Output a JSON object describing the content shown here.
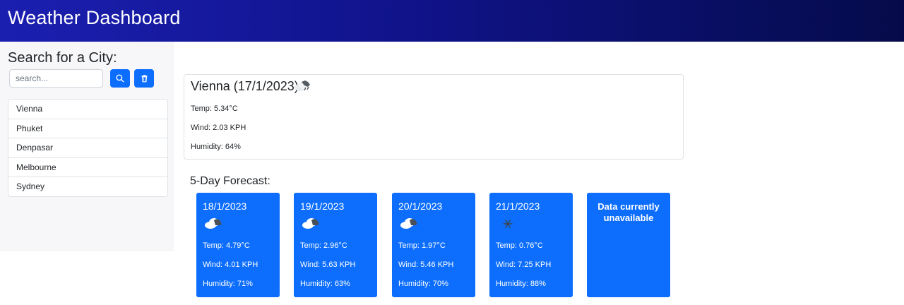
{
  "header": {
    "title": "Weather Dashboard",
    "gradient": [
      "#1b1fb0",
      "#10138a",
      "#050b4a"
    ]
  },
  "sidebar": {
    "heading": "Search for a City:",
    "search": {
      "placeholder": "search...",
      "value": ""
    },
    "search_button_icon": "search-icon",
    "clear_button_icon": "trash-icon",
    "history": [
      "Vienna",
      "Phuket",
      "Denpasar",
      "Melbourne",
      "Sydney"
    ]
  },
  "current": {
    "title": "Vienna (17/1/2023)",
    "icon": "cloud-rain-icon",
    "temp": "Temp: 5.34°C",
    "wind": "Wind: 2.03 KPH",
    "humidity": "Humidity: 64%"
  },
  "forecast": {
    "heading": "5-Day Forecast:",
    "cards": [
      {
        "date": "18/1/2023",
        "icon": "cloud-icon",
        "temp": "Temp: 4.79°C",
        "wind": "Wind: 4.01 KPH",
        "humidity": "Humidity: 71%"
      },
      {
        "date": "19/1/2023",
        "icon": "cloud-icon",
        "temp": "Temp: 2.96°C",
        "wind": "Wind: 5.63 KPH",
        "humidity": "Humidity: 63%"
      },
      {
        "date": "20/1/2023",
        "icon": "cloud-icon",
        "temp": "Temp: 1.97°C",
        "wind": "Wind: 5.46 KPH",
        "humidity": "Humidity: 70%"
      },
      {
        "date": "21/1/2023",
        "icon": "snow-icon",
        "temp": "Temp: 0.76°C",
        "wind": "Wind: 7.25 KPH",
        "humidity": "Humidity: 88%"
      }
    ],
    "unavailable_text": "Data currently unavailable"
  },
  "colors": {
    "accent": "#0d6efd",
    "sidebar_bg": "#f7f7f9",
    "border": "#dee2e6"
  }
}
